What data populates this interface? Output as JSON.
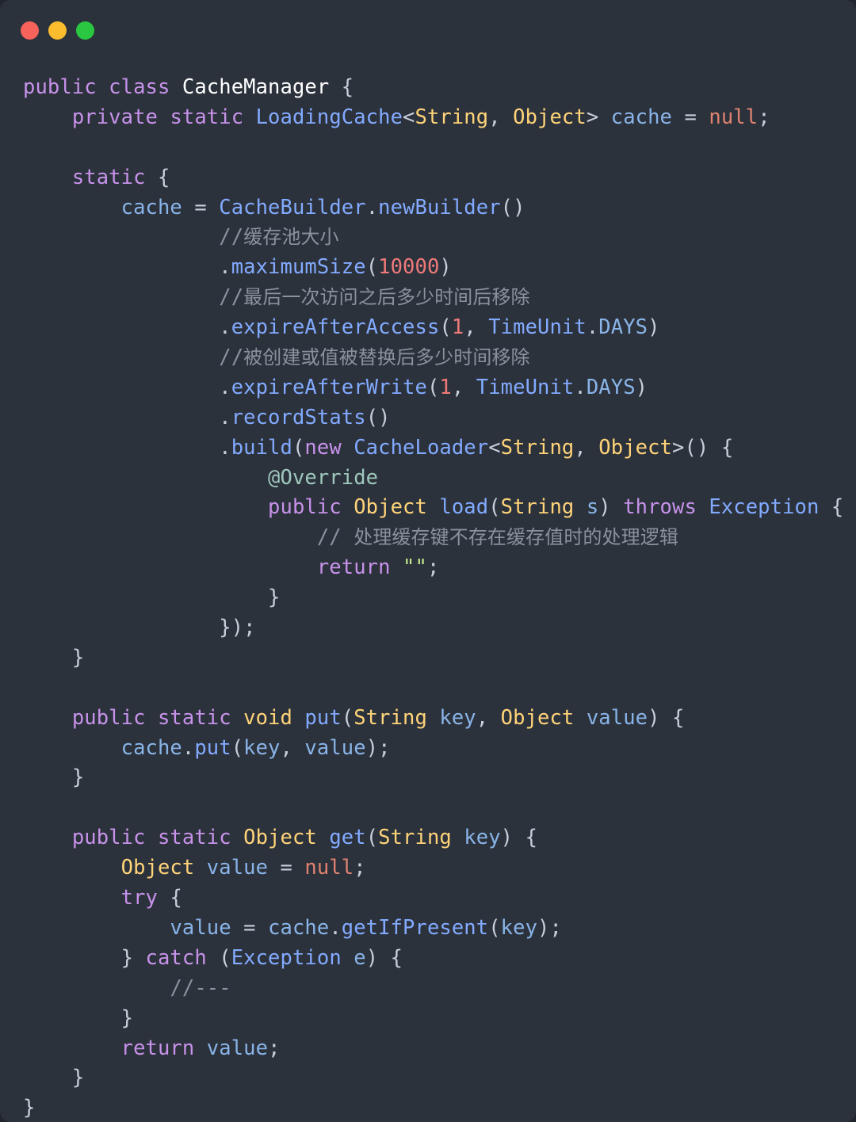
{
  "window": {
    "kind": "macos-code-snippet-window",
    "background_color": "#2c323c",
    "outer_background_color": "#21262e",
    "traffic_lights": [
      {
        "name": "close",
        "label": "Close",
        "color": "#f7625b"
      },
      {
        "name": "minimize",
        "label": "Minimize",
        "color": "#fbbd2e"
      },
      {
        "name": "maximize",
        "label": "Maximize",
        "color": "#2ac840"
      }
    ]
  },
  "editor": {
    "language": "Java",
    "theme": "dark",
    "font_size_px": 25.5,
    "line_height_px": 37.9,
    "palette": {
      "keyword": "#c792ea",
      "type": "#ffd479",
      "class": "#82aaff",
      "function": "#82aaff",
      "variable": "#89b4e8",
      "number": "#f07a7a",
      "null_literal": "#e0826f",
      "string": "#c3e88d",
      "comment": "#8a929e",
      "annotation": "#9fc9bd",
      "punctuation": "#c8cfda",
      "foreground": "#d7dce5"
    },
    "total_lines": 34,
    "lines": [
      "public class CacheManager {",
      "    private static LoadingCache<String, Object> cache = null;",
      "",
      "    static {",
      "        cache = CacheBuilder.newBuilder()",
      "                //缓存池大小",
      "                .maximumSize(10000)",
      "                //最后一次访问之后多少时间后移除",
      "                .expireAfterAccess(1, TimeUnit.DAYS)",
      "                //被创建或值被替换后多少时间移除",
      "                .expireAfterWrite(1, TimeUnit.DAYS)",
      "                .recordStats()",
      "                .build(new CacheLoader<String, Object>() {",
      "                    @Override",
      "                    public Object load(String s) throws Exception {",
      "                        // 处理缓存键不存在缓存值时的处理逻辑",
      "                        return \"\";",
      "                    }",
      "                });",
      "    }",
      "",
      "    public static void put(String key, Object value) {",
      "        cache.put(key, value);",
      "    }",
      "",
      "    public static Object get(String key) {",
      "        Object value = null;",
      "        try {",
      "            value = cache.getIfPresent(key);",
      "        } catch (Exception e) {",
      "            //---",
      "        }",
      "        return value;",
      "    }",
      "}"
    ],
    "identifiers": {
      "class_name": "CacheManager",
      "field": "cache",
      "field_type": "LoadingCache<String, Object>",
      "methods": [
        "put",
        "get",
        "load"
      ],
      "builder_calls": [
        "CacheBuilder.newBuilder()",
        ".maximumSize(10000)",
        ".expireAfterAccess(1, TimeUnit.DAYS)",
        ".expireAfterWrite(1, TimeUnit.DAYS)",
        ".recordStats()",
        ".build(new CacheLoader<String, Object>() { ... })"
      ]
    },
    "comments": [
      "//缓存池大小",
      "//最后一次访问之后多少时间后移除",
      "//被创建或值被替换后多少时间移除",
      "// 处理缓存键不存在缓存值时的处理逻辑",
      "//---"
    ],
    "literals": {
      "maximum_size": "10000",
      "expire_after_access_amount": "1",
      "expire_after_access_unit": "TimeUnit.DAYS",
      "expire_after_write_amount": "1",
      "expire_after_write_unit": "TimeUnit.DAYS",
      "loader_return": "\"\"",
      "field_initial_value": "null",
      "local_initial_value": "null"
    }
  }
}
